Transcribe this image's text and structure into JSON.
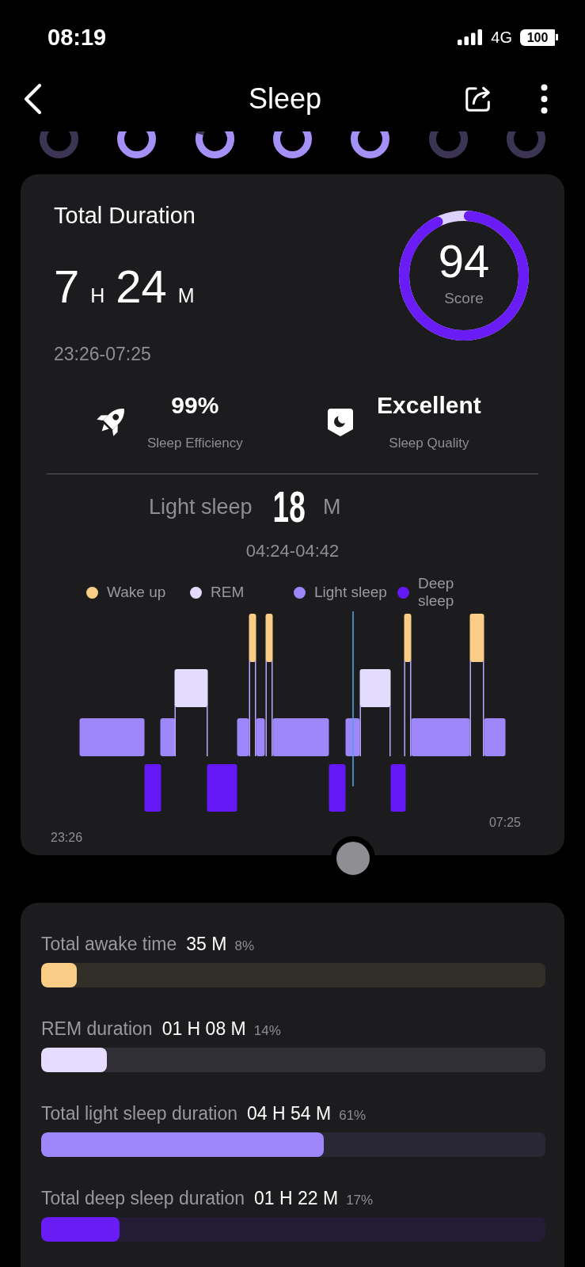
{
  "status_bar": {
    "time": "08:19",
    "network": "4G",
    "battery": "100"
  },
  "header": {
    "title": "Sleep"
  },
  "day_rings": [
    {
      "kind": "empty"
    },
    {
      "kind": "full"
    },
    {
      "kind": "partial"
    },
    {
      "kind": "full"
    },
    {
      "kind": "full"
    },
    {
      "kind": "empty"
    },
    {
      "kind": "empty"
    }
  ],
  "summary": {
    "title": "Total Duration",
    "hours": "7",
    "hours_unit": "H",
    "minutes": "24",
    "minutes_unit": "M",
    "time_range": "23:26-07:25",
    "score": {
      "value": "94",
      "label": "Score",
      "level": 0.94
    },
    "stats": [
      {
        "kind": "efficiency",
        "value": "99%",
        "label": "Sleep Efficiency"
      },
      {
        "kind": "quality",
        "value": "Excellent",
        "label": "Sleep Quality"
      }
    ]
  },
  "selection": {
    "stage": "Light sleep",
    "duration": "18",
    "unit": "M",
    "time_range": "04:24-04:42"
  },
  "legend": [
    {
      "label": "Wake up",
      "color": "#f9cd85"
    },
    {
      "label": "REM",
      "color": "#e4dcff"
    },
    {
      "label": "Light sleep",
      "color": "#9d87fb"
    },
    {
      "label": "Deep sleep",
      "color": "#6418f5"
    }
  ],
  "chart_axis": {
    "start": "23:26",
    "end": "07:25"
  },
  "durations": [
    {
      "label": "Total awake time",
      "value": "35 M",
      "percent": "8%",
      "color": "#f9cd85",
      "level": 0.07
    },
    {
      "label": "REM duration",
      "value": "01 H 08 M",
      "percent": "14%",
      "color": "#e6dcff",
      "level": 0.13
    },
    {
      "label": "Total light sleep duration",
      "value": "04 H 54 M",
      "percent": "61%",
      "color": "#9d87fa",
      "level": 0.56
    },
    {
      "label": "Total deep sleep duration",
      "value": "01 H 22 M",
      "percent": "17%",
      "color": "#6a1cf6",
      "level": 0.155
    }
  ]
}
